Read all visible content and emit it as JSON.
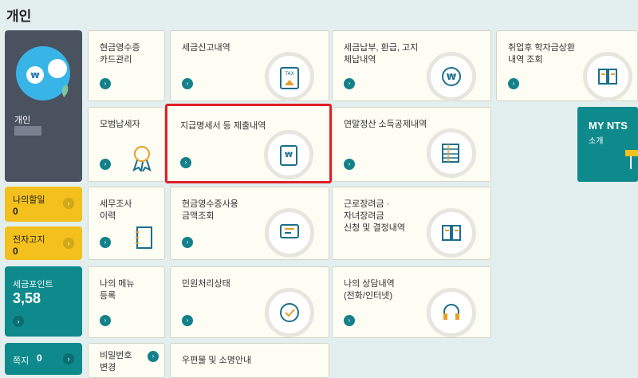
{
  "page": {
    "title": "개인"
  },
  "profile": {
    "label": "개인"
  },
  "side": {
    "discount": {
      "label": "나의할일",
      "value": "0"
    },
    "notice": {
      "label": "전자고지",
      "value": "0"
    },
    "points": {
      "label": "세금포인트",
      "value": "3,58"
    },
    "message": {
      "label": "쪽지",
      "value": "0"
    }
  },
  "tiles": {
    "cash_receipt_card": "현금영수증\n카드관리",
    "tax_report": "세금신고내역",
    "tax_payment": "세금납부, 환급, 고지\n체납내역",
    "student_loan": "취업후 학자금상환\n내역 조회",
    "exemplary_taxpayer": "모범납세자",
    "withholding": "지급명세서 등 제출내역",
    "year_end": "연말정산 소득공제내역",
    "tax_audit": "세무조사\n이력",
    "cash_receipt_usage": "현금영수증사용\n금액조회",
    "earned_income_credit": "근로장려금 ·\n자녀장려금\n신청 및 결정내역",
    "my_menu": "나의 메뉴\n등록",
    "complaint": "민원처리상태",
    "consultation": "나의 상담내역\n(전화/인터넷)",
    "password": "비밀번호\n변경",
    "mail": "우편물 및 소명안내"
  },
  "mynts": {
    "title": "MY NTS",
    "subtitle": "소개"
  },
  "icons": {
    "arrow": "›",
    "won": "₩",
    "tax_doc": "TAX"
  }
}
